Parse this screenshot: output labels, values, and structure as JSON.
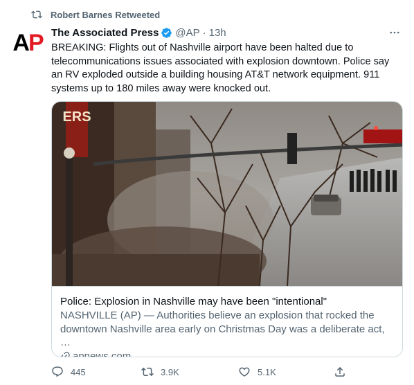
{
  "retweeted_by": "Robert Barnes Retweeted",
  "author": {
    "display_name": "The Associated Press",
    "handle": "@AP",
    "separator": "·",
    "time": "13h",
    "avatar_text": "AP"
  },
  "tweet_text": "BREAKING: Flights out of Nashville airport have been halted due to telecommunications issues associated with explosion downtown. Police say an RV exploded outside a building housing AT&T network equipment. 911 systems up to 180 miles away were knocked out.",
  "card": {
    "title": "Police: Explosion in Nashville may have been \"intentional\"",
    "description": "NASHVILLE (AP) — Authorities believe an explosion that rocked the downtown Nashville area early on Christmas Day was a deliberate act, …",
    "domain": "apnews.com",
    "image_sign_text": "ERS"
  },
  "actions": {
    "replies": "445",
    "retweets": "3.9K",
    "likes": "5.1K"
  },
  "colors": {
    "accent": "#1d9bf0",
    "ap_red": "#e21b22",
    "muted": "#536471"
  }
}
